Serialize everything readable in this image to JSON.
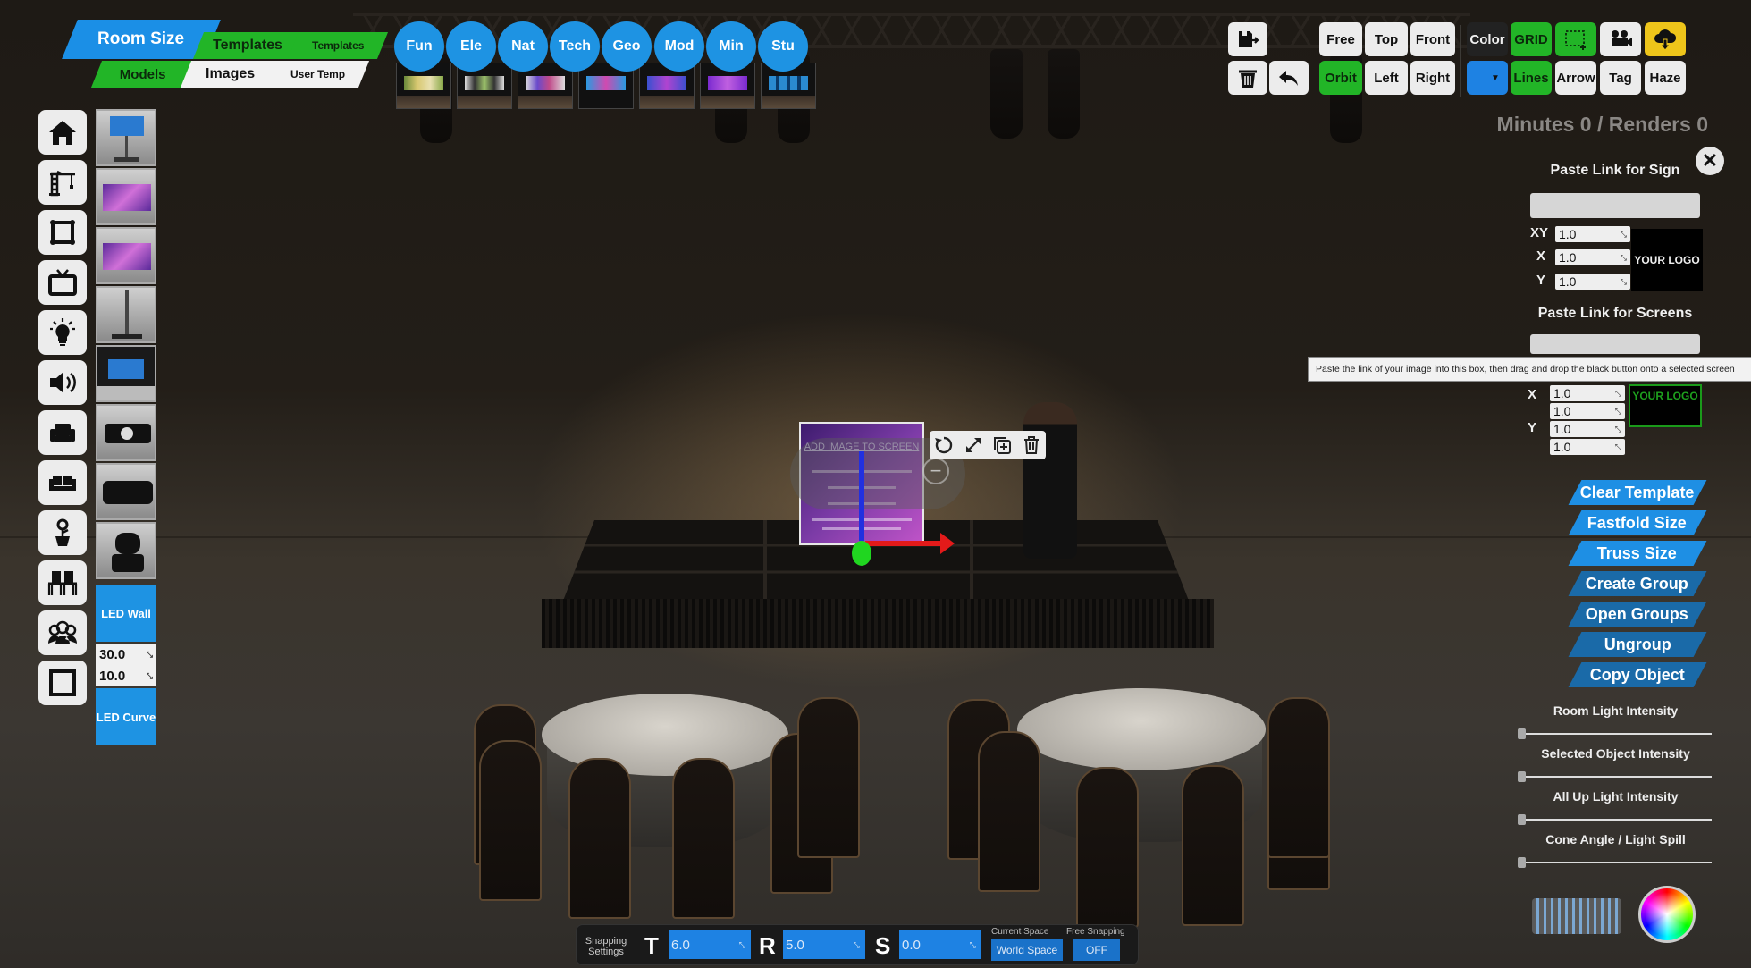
{
  "nav_tabs": {
    "room_size": "Room Size",
    "templates": "Templates",
    "templates_small": "Templates",
    "models": "Models",
    "images": "Images",
    "user_temp": "User Temp"
  },
  "template_categories": [
    {
      "label": "Fun"
    },
    {
      "label": "Ele"
    },
    {
      "label": "Nat"
    },
    {
      "label": "Tech"
    },
    {
      "label": "Geo"
    },
    {
      "label": "Mod"
    },
    {
      "label": "Min"
    },
    {
      "label": "Stu"
    }
  ],
  "left_toolbar": {
    "icons": [
      "home-icon",
      "crane-icon",
      "frame-icon",
      "tv-icon",
      "lightbulb-icon",
      "speaker-icon",
      "armchair-icon",
      "sofa-icon",
      "plant-icon",
      "chairs-icon",
      "people-icon",
      "square-icon"
    ]
  },
  "model_thumbnails": [
    "screen-on-stand",
    "purple-tv-screen",
    "purple-tv-screen",
    "pole-stand",
    "screen-with-drape",
    "projector",
    "video-camera",
    "ptz-camera"
  ],
  "led": {
    "wall_label": "LED Wall",
    "width_value": "30.0",
    "height_value": "10.0",
    "curve_label": "LED Curve"
  },
  "view_buttons": {
    "free": "Free",
    "top": "Top",
    "front": "Front",
    "orbit": "Orbit",
    "left": "Left",
    "right": "Right"
  },
  "tool_buttons": {
    "color": "Color",
    "grid": "GRID",
    "lines": "Lines",
    "arrow": "Arrow",
    "tag": "Tag",
    "haze": "Haze",
    "color_swatch": "#1e82e3"
  },
  "status": {
    "minutes_renders": "Minutes 0 / Renders 0"
  },
  "sign_panel": {
    "title": "Paste Link for Sign",
    "link_value": "",
    "xy_label": "XY",
    "xy_value": "1.0",
    "x_label": "X",
    "x_value": "1.0",
    "y_label": "Y",
    "y_value": "1.0",
    "logo_label": "YOUR LOGO"
  },
  "screens_panel": {
    "title": "Paste Link for Screens",
    "link_value": "",
    "tooltip": "Paste the link of your image into this box, then drag and drop the black button onto a selected screen",
    "x_label": "X",
    "x_value_1": "1.0",
    "x_value_2": "1.0",
    "y_label": "Y",
    "y_value_1": "1.0",
    "y_value_2": "1.0",
    "logo_label": "YOUR LOGO"
  },
  "actions": [
    {
      "label": "Clear Template"
    },
    {
      "label": "Fastfold Size"
    },
    {
      "label": "Truss Size"
    },
    {
      "label": "Create Group"
    },
    {
      "label": "Open Groups"
    },
    {
      "label": "Ungroup"
    },
    {
      "label": "Copy Object"
    }
  ],
  "sliders": [
    {
      "label": "Room Light Intensity",
      "value": 0
    },
    {
      "label": "Selected Object Intensity",
      "value": 0
    },
    {
      "label": "All Up Light Intensity",
      "value": 0
    },
    {
      "label": "Cone Angle / Light Spill",
      "value": 0
    }
  ],
  "selected_object": {
    "title": "ADD IMAGE TO SCREEN"
  },
  "snapping": {
    "label_line1": "Snapping",
    "label_line2": "Settings",
    "t_label": "T",
    "t_value": "6.0",
    "r_label": "R",
    "r_value": "5.0",
    "s_label": "S",
    "s_value": "0.0",
    "current_space_caption": "Current Space",
    "current_space_value": "World Space",
    "free_snapping_caption": "Free Snapping",
    "free_snapping_value": "OFF"
  }
}
